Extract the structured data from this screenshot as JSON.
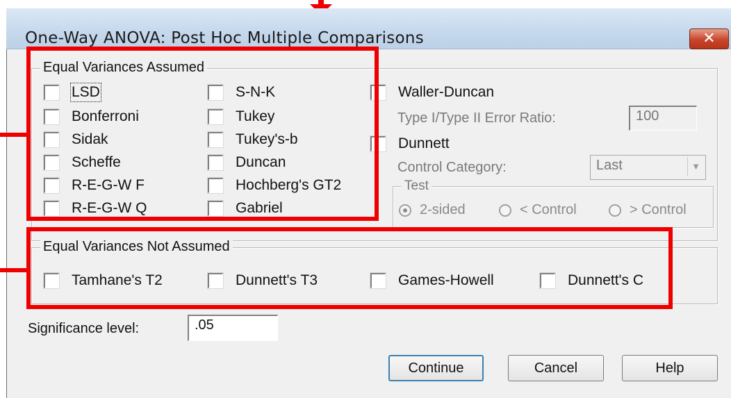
{
  "window": {
    "title": "One-Way ANOVA: Post Hoc Multiple Comparisons",
    "close_label": "✕"
  },
  "equal_assumed": {
    "legend": "Equal Variances Assumed",
    "col1": [
      "LSD",
      "Bonferroni",
      "Sidak",
      "Scheffe",
      "R-E-G-W F",
      "R-E-G-W Q"
    ],
    "col2": [
      "S-N-K",
      "Tukey",
      "Tukey's-b",
      "Duncan",
      "Hochberg's GT2",
      "Gabriel"
    ],
    "waller_duncan": "Waller-Duncan",
    "error_ratio_label": "Type I/Type II Error Ratio:",
    "error_ratio_value": "100",
    "dunnett": "Dunnett",
    "control_category_label": "Control Category:",
    "control_category_value": "Last",
    "test_legend": "Test",
    "test_options": [
      "2-sided",
      "< Control",
      "> Control"
    ],
    "test_selected": "2-sided"
  },
  "not_assumed": {
    "legend": "Equal Variances Not Assumed",
    "options": [
      "Tamhane's T2",
      "Dunnett's T3",
      "Games-Howell",
      "Dunnett's C"
    ]
  },
  "significance": {
    "label": "Significance level:",
    "value": ".05"
  },
  "buttons": {
    "continue": "Continue",
    "cancel": "Cancel",
    "help": "Help"
  },
  "colors": {
    "annotation": "#e00000",
    "title_bar": "#c5d8ec",
    "close_button": "#c7452a",
    "dialog_bg": "#f0f0f0"
  }
}
